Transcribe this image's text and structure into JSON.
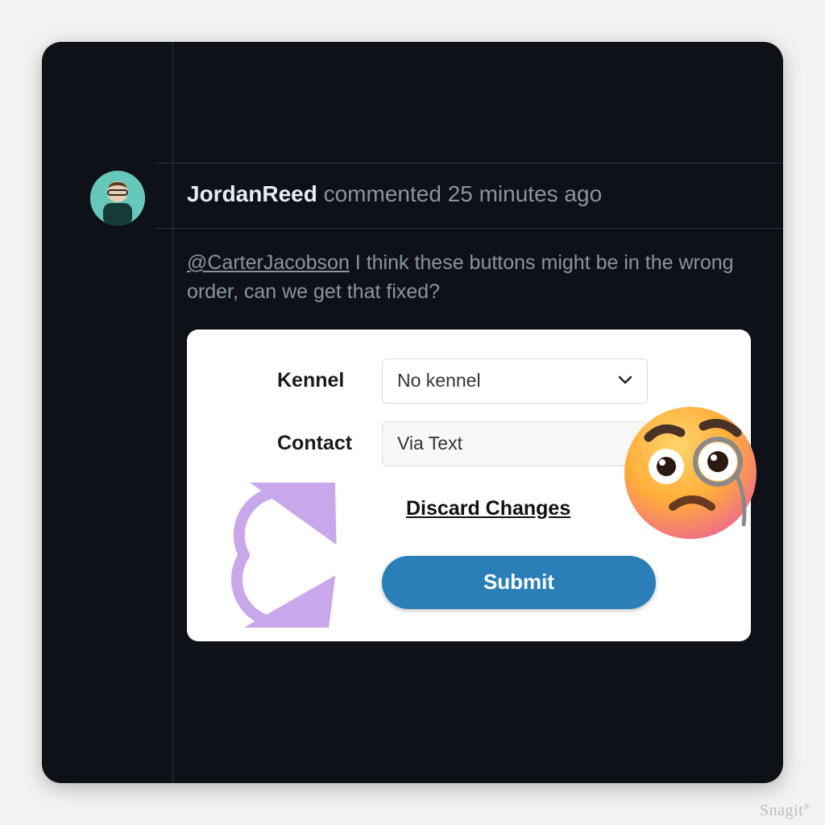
{
  "comment": {
    "author": "JordanReed",
    "action_text": "commented",
    "timestamp": "25 minutes ago",
    "mention": "@CarterJacobson",
    "body_rest": " I think these buttons might be in the wrong order, can we get that fixed?"
  },
  "form": {
    "kennel_label": "Kennel",
    "kennel_value": "No kennel",
    "contact_label": "Contact",
    "contact_value": "Via Text",
    "discard_label": "Discard Changes",
    "submit_label": "Submit"
  },
  "icons": {
    "swap_arrow": "swap-arrow",
    "monocle_emoji": "face-with-monocle"
  },
  "watermark": "Snagit"
}
